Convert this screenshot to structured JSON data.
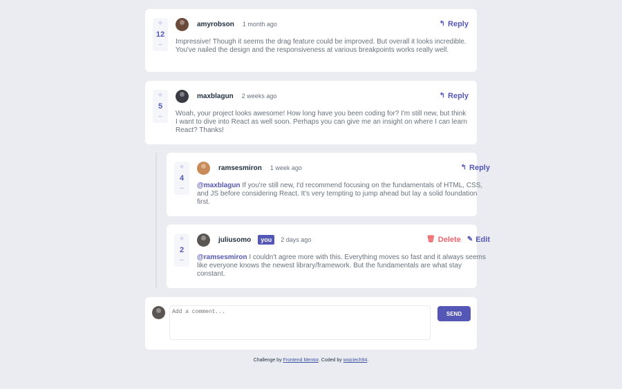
{
  "colors": {
    "background": "#eaecf1",
    "accent": "#5457b6",
    "delete": "#ed6468",
    "card": "#ffffff"
  },
  "comments": [
    {
      "score": "12",
      "username": "amyrobson",
      "time": "1 month ago",
      "avatar_color": "#6b4a3a",
      "action_reply": "Reply",
      "mention": "",
      "text": "Impressive! Though it seems the drag feature could be improved. But overall it looks incredible. You've nailed the design and the responsiveness at various breakpoints works really well."
    },
    {
      "score": "5",
      "username": "maxblagun",
      "time": "2 weeks ago",
      "avatar_color": "#3a3a44",
      "action_reply": "Reply",
      "mention": "",
      "text": "Woah, your project looks awesome! How long have you been coding for? I'm still new, but think I want to dive into React as well soon. Perhaps you can give me an insight on where I can learn React? Thanks!"
    }
  ],
  "replies": [
    {
      "score": "4",
      "username": "ramsesmiron",
      "time": "1 week ago",
      "avatar_color": "#c88a56",
      "action_reply": "Reply",
      "mention": "@maxblagun",
      "text": " If you're still new, I'd recommend focusing on the fundamentals of HTML, CSS, and JS before considering React. It's very tempting to jump ahead but lay a solid foundation first."
    },
    {
      "score": "2",
      "username": "juliusomo",
      "badge": "you",
      "time": "2 days ago",
      "avatar_color": "#5a5550",
      "action_delete": "Delete",
      "action_edit": "Edit",
      "mention": "@ramsesmiron",
      "text": " I couldn't agree more with this. Everything moves so fast and it always seems like everyone knows the newest library/framework. But the fundamentals are what stay constant."
    }
  ],
  "vote": {
    "plus": "+",
    "minus": "−"
  },
  "add_comment": {
    "placeholder": "Add a comment...",
    "send_label": "SEND",
    "avatar_color": "#5a5550"
  },
  "icons": {
    "reply": "reply-arrow-icon",
    "delete": "trash-icon",
    "edit": "pencil-icon"
  },
  "attribution": {
    "prefix": "Challenge by ",
    "link1": "Frontend Mentor",
    "middle": ". Coded by ",
    "link2": "wojciech94",
    "suffix": "."
  }
}
